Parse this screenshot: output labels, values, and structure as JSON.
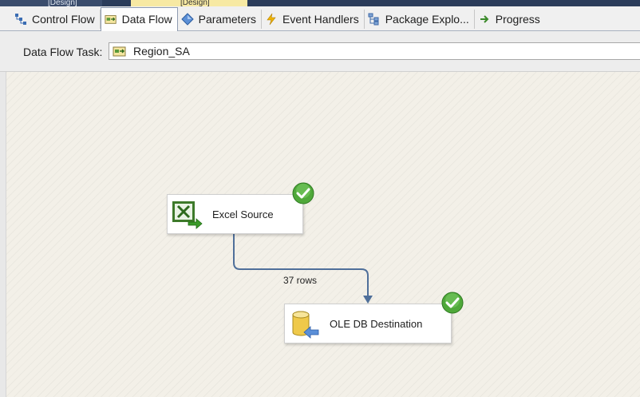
{
  "colors": {
    "doc_strip": "#2b3c5a",
    "active_doc_tab": "#f7e9a3",
    "canvas_bg": "#f3f0e8",
    "flow_line": "#4f6f9a",
    "success_green": "#4fa83a"
  },
  "doc_tabs": [
    {
      "label": "[Design]",
      "active": false
    },
    {
      "label": "[Design]",
      "active": true
    }
  ],
  "designer_tabs": [
    {
      "label": "Control Flow",
      "icon": "control-flow-icon",
      "active": false
    },
    {
      "label": "Data Flow",
      "icon": "data-flow-icon",
      "active": true
    },
    {
      "label": "Parameters",
      "icon": "parameters-icon",
      "active": false
    },
    {
      "label": "Event Handlers",
      "icon": "event-handlers-icon",
      "active": false
    },
    {
      "label": "Package Explo...",
      "icon": "package-explorer-icon",
      "active": false
    },
    {
      "label": "Progress",
      "icon": "progress-icon",
      "active": false
    }
  ],
  "task_selector": {
    "label": "Data Flow Task:",
    "value": "Region_SA",
    "icon": "data-flow-task-icon"
  },
  "components": {
    "source": {
      "label": "Excel Source",
      "icon": "excel-source-icon",
      "status": "success"
    },
    "destination": {
      "label": "OLE DB Destination",
      "icon": "ole-db-destination-icon",
      "status": "success"
    }
  },
  "path": {
    "label": "37 rows",
    "row_count": 37
  }
}
